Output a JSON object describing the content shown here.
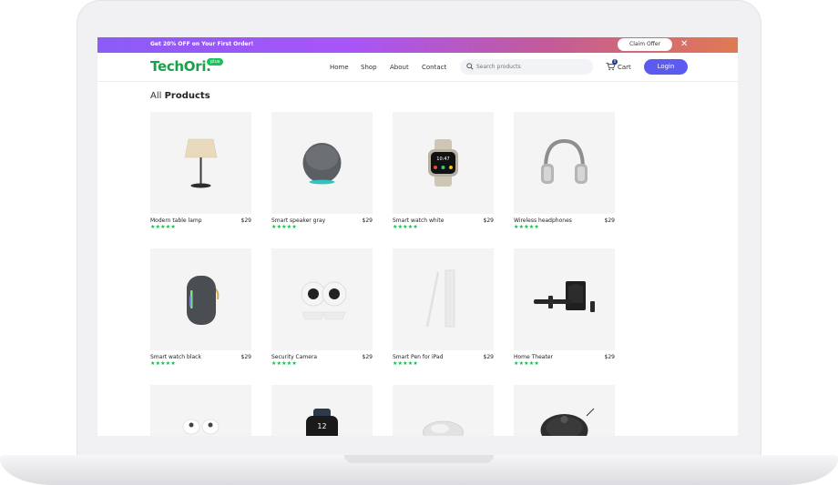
{
  "promo": {
    "text": "Get 20% OFF on Your First Order!",
    "claim_label": "Claim Offer",
    "close_glyph": "✕"
  },
  "nav": {
    "logo": "TechOri.",
    "logo_badge": "plus",
    "links": [
      "Home",
      "Shop",
      "About",
      "Contact"
    ],
    "search_placeholder": "Search products",
    "cart_label": "Cart",
    "cart_count": "0",
    "login_label": "Login"
  },
  "heading": {
    "light": "All",
    "bold": "Products"
  },
  "products": [
    {
      "name": "Modern table lamp",
      "price": "$29",
      "rating": 5,
      "stars": "★★★★★",
      "icon": "lamp-icon"
    },
    {
      "name": "Smart speaker gray",
      "price": "$29",
      "rating": 5,
      "stars": "★★★★★",
      "icon": "speaker-icon"
    },
    {
      "name": "Smart watch white",
      "price": "$29",
      "rating": 5,
      "stars": "★★★★★",
      "icon": "watch-icon"
    },
    {
      "name": "Wireless headphones",
      "price": "$29",
      "rating": 5,
      "stars": "★★★★★",
      "icon": "headphones-icon"
    },
    {
      "name": "Smart watch black",
      "price": "$29",
      "rating": 5,
      "stars": "★★★★★",
      "icon": "bluetooth-speaker-icon"
    },
    {
      "name": "Security Camera",
      "price": "$29",
      "rating": 5,
      "stars": "★★★★★",
      "icon": "camera-icon"
    },
    {
      "name": "Smart Pen for iPad",
      "price": "$29",
      "rating": 5,
      "stars": "★★★★★",
      "icon": "pen-icon"
    },
    {
      "name": "Home Theater",
      "price": "$29",
      "rating": 5,
      "stars": "★★★★★",
      "icon": "home-theater-icon"
    },
    {
      "name": "",
      "price": "",
      "icon": "earbuds-icon"
    },
    {
      "name": "",
      "price": "",
      "icon": "watch-black-icon"
    },
    {
      "name": "",
      "price": "",
      "icon": "mouse-icon"
    },
    {
      "name": "",
      "price": "",
      "icon": "robot-vacuum-icon"
    }
  ],
  "colors": {
    "brand_green": "#1a9f4a",
    "login_blue": "#5b5bf0",
    "star_green": "#12b94c",
    "promo_gradient_start": "#8b5cf6",
    "promo_gradient_end": "#e07a52"
  }
}
